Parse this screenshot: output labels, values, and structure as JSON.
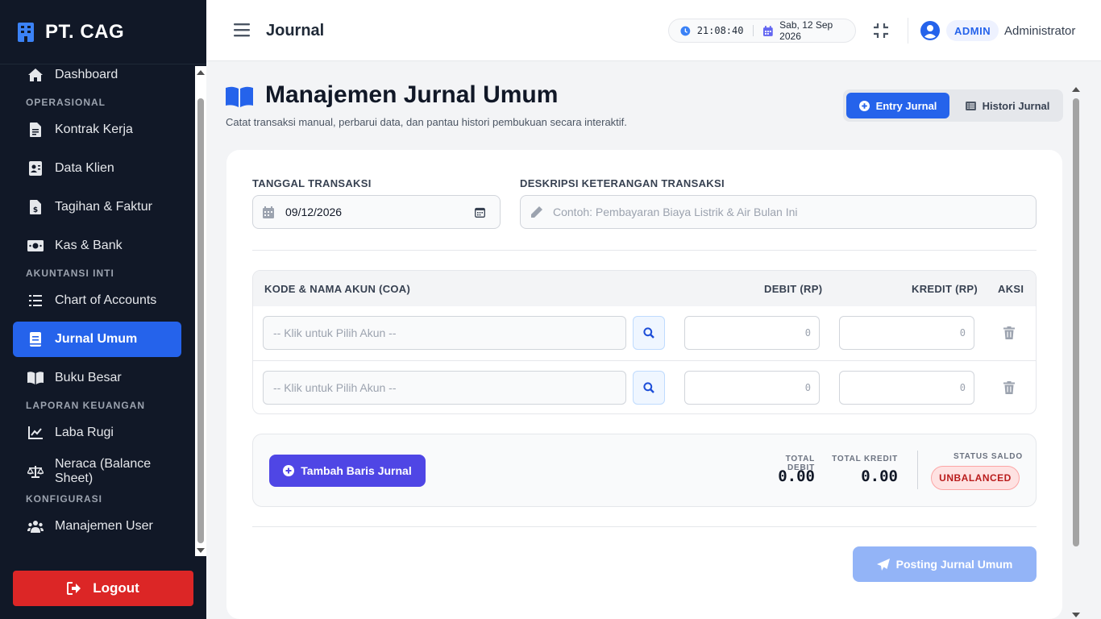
{
  "brand": {
    "name": "PT. CAG"
  },
  "sidebar": {
    "items": [
      {
        "label": "Dashboard",
        "icon": "home-icon"
      },
      {
        "section": "OPERASIONAL"
      },
      {
        "label": "Kontrak Kerja",
        "icon": "file-contract-icon"
      },
      {
        "label": "Data Klien",
        "icon": "address-card-icon"
      },
      {
        "label": "Tagihan & Faktur",
        "icon": "invoice-icon"
      },
      {
        "label": "Kas & Bank",
        "icon": "money-icon"
      },
      {
        "section": "AKUNTANSI INTI"
      },
      {
        "label": "Chart of Accounts",
        "icon": "list-icon"
      },
      {
        "label": "Jurnal Umum",
        "icon": "book-icon",
        "active": true
      },
      {
        "label": "Buku Besar",
        "icon": "book-open-icon"
      },
      {
        "section": "LAPORAN KEUANGAN"
      },
      {
        "label": "Laba Rugi",
        "icon": "chart-line-icon"
      },
      {
        "label": "Neraca (Balance Sheet)",
        "icon": "scale-icon"
      },
      {
        "section": "KONFIGURASI"
      },
      {
        "label": "Manajemen User",
        "icon": "users-icon"
      }
    ],
    "logout_label": "Logout"
  },
  "topbar": {
    "title": "Journal",
    "time": "21:08:40",
    "date": "Sab, 12 Sep 2026",
    "role": "ADMIN",
    "user": "Administrator"
  },
  "main": {
    "title": "Manajemen Jurnal Umum",
    "subtitle": "Catat transaksi manual, perbarui data, dan pantau histori pembukuan secara interaktif.",
    "tabs": [
      {
        "label": "Entry Jurnal",
        "active": true
      },
      {
        "label": "Histori Jurnal",
        "active": false
      }
    ]
  },
  "form": {
    "date_label": "TANGGAL TRANSAKSI",
    "date_value": "09/12/2026",
    "desc_label": "DESKRIPSI KETERANGAN TRANSAKSI",
    "desc_placeholder": "Contoh: Pembayaran Biaya Listrik & Air Bulan Ini"
  },
  "table": {
    "headers": {
      "account": "KODE & NAMA AKUN (COA)",
      "debit": "DEBIT (RP)",
      "kredit": "KREDIT (RP)",
      "aksi": "AKSI"
    },
    "rows": [
      {
        "account_placeholder": "-- Klik untuk Pilih Akun --",
        "debit": "0",
        "kredit": "0"
      },
      {
        "account_placeholder": "-- Klik untuk Pilih Akun --",
        "debit": "0",
        "kredit": "0"
      }
    ]
  },
  "summary": {
    "add_row_label": "Tambah Baris Jurnal",
    "total_debit_label": "TOTAL DEBIT",
    "total_debit": "0.00",
    "total_kredit_label": "TOTAL KREDIT",
    "total_kredit": "0.00",
    "status_label": "STATUS SALDO",
    "status": "UNBALANCED"
  },
  "actions": {
    "post_label": "Posting Jurnal Umum"
  },
  "colors": {
    "primary": "#2563eb",
    "sidebar": "#111827",
    "danger": "#dc2626",
    "indigo": "#4f46e5"
  }
}
